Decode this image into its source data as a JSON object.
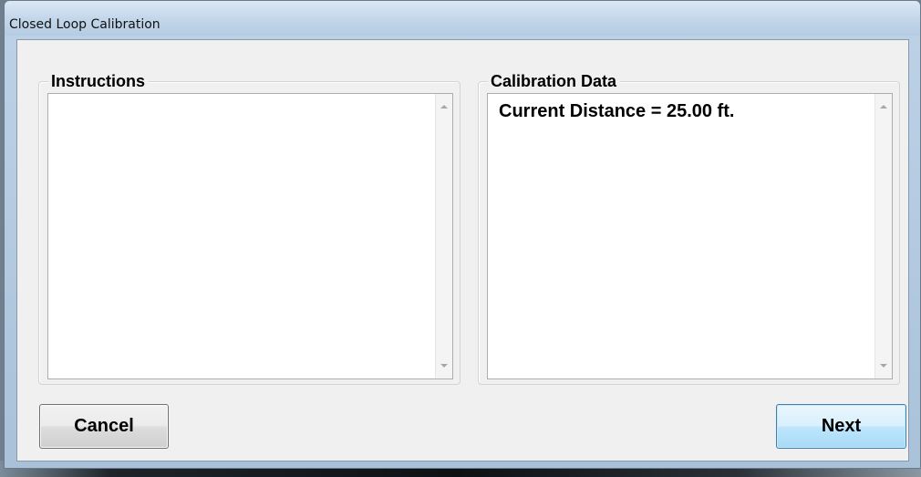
{
  "window": {
    "title": "Closed Loop Calibration"
  },
  "instructions": {
    "legend": "Instructions",
    "text": ""
  },
  "calibration": {
    "legend": "Calibration Data",
    "text": "Current Distance = 25.00 ft."
  },
  "buttons": {
    "cancel_label": "Cancel",
    "next_label": "Next"
  },
  "icons": {
    "scroll_up": "scroll-up-arrow-icon",
    "scroll_down": "scroll-down-arrow-icon"
  },
  "colors": {
    "default_button_border": "#3c7fb1",
    "default_button_fill": "#bee6fd",
    "client_background": "#f0f0f0"
  }
}
